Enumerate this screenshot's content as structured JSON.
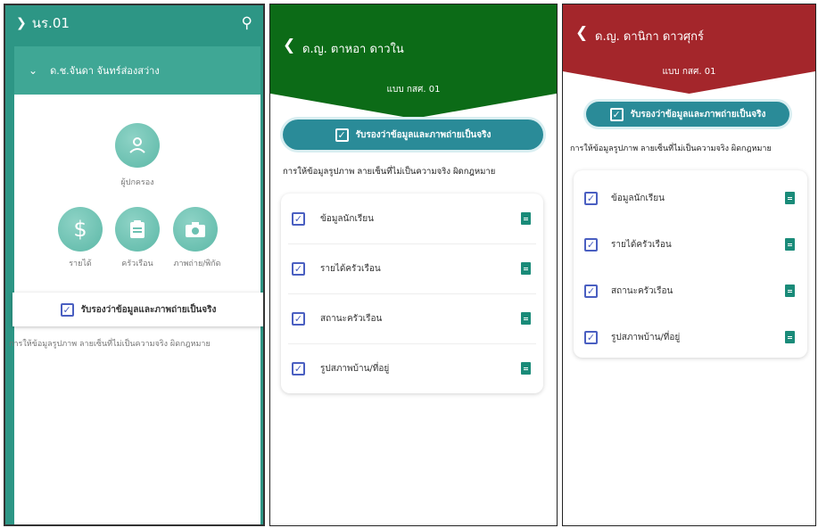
{
  "panel1": {
    "title": "นร.01",
    "student_name": "ด.ช.จันดา จันทร์ส่องสว่าง",
    "items": {
      "guardian": "ผู้ปกครอง",
      "income": "รายได้",
      "household": "ครัวเรือน",
      "photo": "ภาพถ่าย/พิกัด"
    },
    "certify": "รับรองว่าข้อมูลและภาพถ่ายเป็นจริง",
    "warning": "การให้ข้อมูลรูปภาพ ลายเซ็นที่ไม่เป็นความจริง ผิดกฎหมาย"
  },
  "panel2": {
    "name": "ด.ญ. ตาหอา ดาวใน",
    "form": "แบบ กสศ. 01",
    "certify": "รับรองว่าข้อมูลและภาพถ่ายเป็นจริง",
    "warning": "การให้ข้อมูลรูปภาพ ลายเซ็นที่ไม่เป็นความจริง ผิดกฎหมาย",
    "rows": [
      "ข้อมูลนักเรียน",
      "รายได้ครัวเรือน",
      "สถานะครัวเรือน",
      "รูปสภาพบ้าน/ที่อยู่"
    ]
  },
  "panel3": {
    "name": "ด.ญ. ดานิกา ดาวศุกร์",
    "form": "แบบ กสศ. 01",
    "certify": "รับรองว่าข้อมูลและภาพถ่ายเป็นจริง",
    "warning": "การให้ข้อมูลรูปภาพ ลายเซ็นที่ไม่เป็นความจริง ผิดกฎหมาย",
    "rows": [
      "ข้อมูลนักเรียน",
      "รายได้ครัวเรือน",
      "สถานะครัวเรือน",
      "รูปสภาพบ้าน/ที่อยู่"
    ]
  },
  "colors": {
    "teal": "#2d9685",
    "green_header": "#0c6b17",
    "red_header": "#a4262b",
    "certify_button": "#2a8b98",
    "checkbox": "#4a5fc1"
  }
}
